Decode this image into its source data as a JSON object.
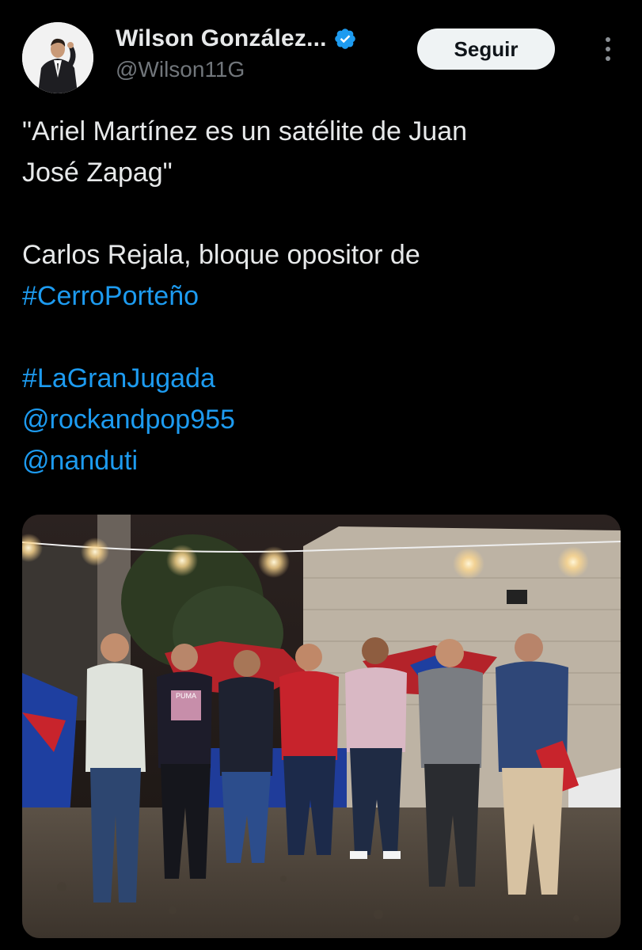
{
  "author": {
    "display_name": "Wilson González...",
    "handle": "@Wilson11G",
    "verified": true
  },
  "follow_button": {
    "label": "Seguir"
  },
  "more_icon": "more-vertical-icon",
  "tweet": {
    "line1": "\"Ariel Martínez es un satélite de Juan",
    "line2": "José Zapag\"",
    "line3": "Carlos Rejala, bloque opositor de",
    "hashtag1": "#CerroPorteño",
    "hashtag2": "#LaGranJugada",
    "mention1": "@rockandpop955",
    "mention2": "@nanduti"
  },
  "photo_text": {
    "shirt_print": "PUMA"
  },
  "colors": {
    "background": "#000000",
    "text": "#e7e9ea",
    "secondary": "#71767b",
    "link": "#1d9bf0",
    "follow_bg": "#eff3f4",
    "verified": "#1d9bf0"
  }
}
